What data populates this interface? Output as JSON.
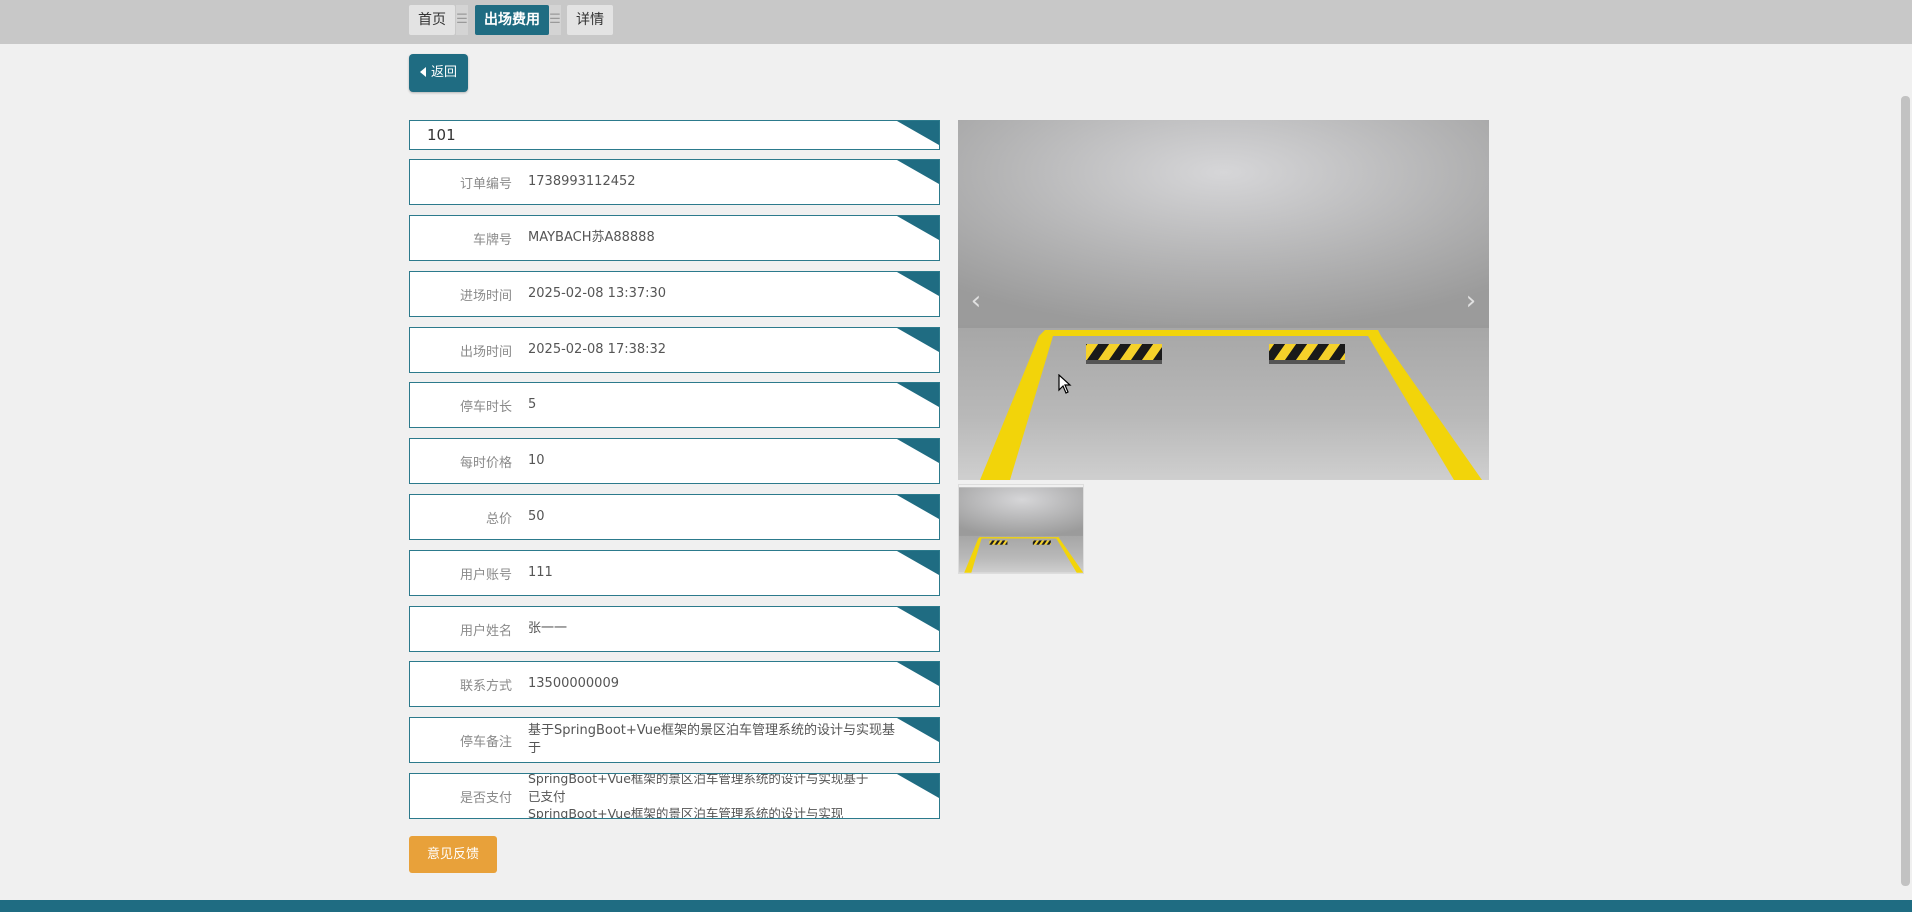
{
  "breadcrumb": {
    "items": [
      "首页",
      "出场费用",
      "详情"
    ],
    "separator": "☰"
  },
  "back_button": {
    "label": "返回",
    "icon": "chevron-left-icon"
  },
  "record_title": "101",
  "fields": [
    {
      "label": "订单编号",
      "value": "1738993112452"
    },
    {
      "label": "车牌号",
      "value": "MAYBACH苏A88888"
    },
    {
      "label": "进场时间",
      "value": "2025-02-08 13:37:30"
    },
    {
      "label": "出场时间",
      "value": "2025-02-08 17:38:32"
    },
    {
      "label": "停车时长",
      "value": "5"
    },
    {
      "label": "每时价格",
      "value": "10"
    },
    {
      "label": "总价",
      "value": "50"
    },
    {
      "label": "用户账号",
      "value": "111"
    },
    {
      "label": "用户姓名",
      "value": "张一一"
    },
    {
      "label": "联系方式",
      "value": "13500000009"
    },
    {
      "label": "停车备注",
      "value": "基于SpringBoot+Vue框架的景区泊车管理系统的设计与实现基于"
    },
    {
      "label": "是否支付",
      "value_lines": [
        "SpringBoot+Vue框架的景区泊车管理系统的设计与实现基于",
        "已支付",
        "SpringBoot+Vue框架的景区泊车管理系统的设计与实现"
      ]
    }
  ],
  "carousel": {
    "prev_icon": "‹",
    "next_icon": "›",
    "image": "parking-space-image"
  },
  "feedback_button": {
    "label": "意见反馈"
  },
  "colors": {
    "primary": "#1f6c82",
    "accent": "#e8a13a",
    "background": "#f0f0f0",
    "topbar": "#c8c8c8"
  }
}
